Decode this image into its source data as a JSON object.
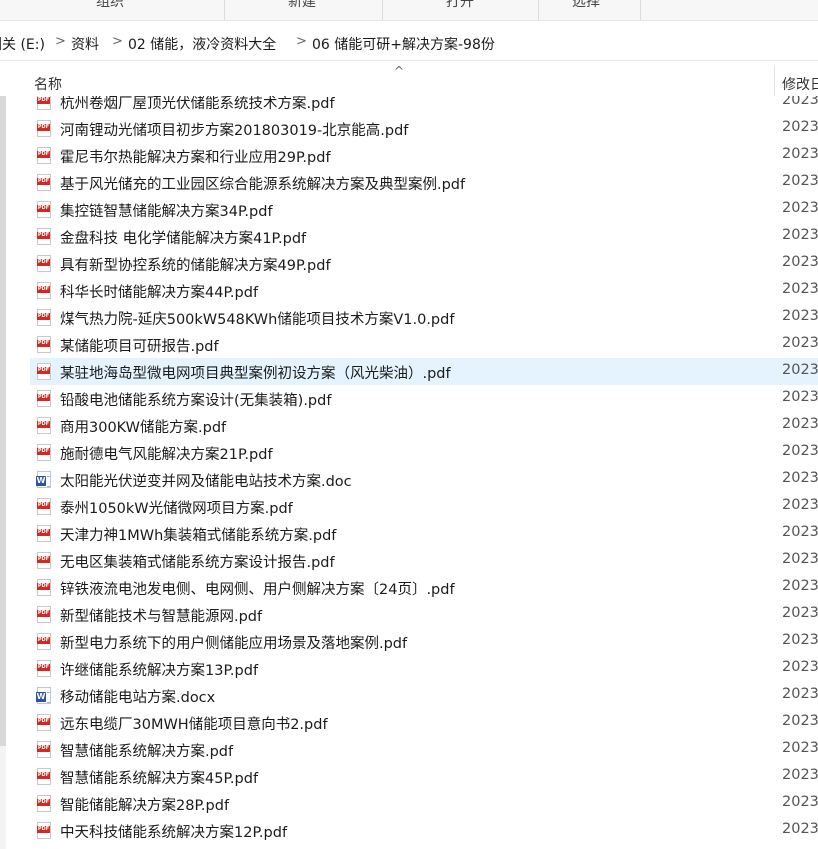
{
  "ribbon": {
    "groups": [
      {
        "label": "组织"
      },
      {
        "label": "新建"
      },
      {
        "label": "打开"
      },
      {
        "label": "选择"
      }
    ]
  },
  "address": {
    "crumbs": [
      {
        "label": "淵关 (E:)"
      },
      {
        "label": "资料"
      },
      {
        "label": "02 储能，液冷资料大全"
      },
      {
        "label": "06  储能可研+解决方案-98份"
      }
    ],
    "separator": ">"
  },
  "columns": {
    "name": "名称",
    "modified": "修改日",
    "sort_indicator": "^"
  },
  "files": [
    {
      "name": "杭州卷烟厂屋顶光伏储能系统技术方案.pdf",
      "date": "2023",
      "type": "pdf",
      "selected": false
    },
    {
      "name": "河南锂动光储项目初步方案201803019-北京能高.pdf",
      "date": "2023",
      "type": "pdf",
      "selected": false
    },
    {
      "name": "霍尼韦尔热能解决方案和行业应用29P.pdf",
      "date": "2023",
      "type": "pdf",
      "selected": false
    },
    {
      "name": "基于风光储充的工业园区综合能源系统解决方案及典型案例.pdf",
      "date": "2023",
      "type": "pdf",
      "selected": false
    },
    {
      "name": "集控链智慧储能解决方案34P.pdf",
      "date": "2023",
      "type": "pdf",
      "selected": false
    },
    {
      "name": "金盘科技 电化学储能解决方案41P.pdf",
      "date": "2023",
      "type": "pdf",
      "selected": false
    },
    {
      "name": "具有新型协控系统的储能解决方案49P.pdf",
      "date": "2023",
      "type": "pdf",
      "selected": false
    },
    {
      "name": "科华长时储能解决方案44P.pdf",
      "date": "2023",
      "type": "pdf",
      "selected": false
    },
    {
      "name": "煤气热力院-延庆500kW548KWh储能项目技术方案V1.0.pdf",
      "date": "2023",
      "type": "pdf",
      "selected": false
    },
    {
      "name": "某储能项目可研报告.pdf",
      "date": "2023",
      "type": "pdf",
      "selected": false
    },
    {
      "name": "某驻地海岛型微电网项目典型案例初设方案（风光柴油）.pdf",
      "date": "2023",
      "type": "pdf",
      "selected": true
    },
    {
      "name": "铅酸电池储能系统方案设计(无集装箱).pdf",
      "date": "2023",
      "type": "pdf",
      "selected": false
    },
    {
      "name": "商用300KW储能方案.pdf",
      "date": "2023",
      "type": "pdf",
      "selected": false
    },
    {
      "name": "施耐德电气风能解决方案21P.pdf",
      "date": "2023",
      "type": "pdf",
      "selected": false
    },
    {
      "name": "太阳能光伏逆变并网及储能电站技术方案.doc",
      "date": "2023",
      "type": "word",
      "selected": false
    },
    {
      "name": "泰州1050kW光储微网项目方案.pdf",
      "date": "2023",
      "type": "pdf",
      "selected": false
    },
    {
      "name": "天津力神1MWh集装箱式储能系统方案.pdf",
      "date": "2023",
      "type": "pdf",
      "selected": false
    },
    {
      "name": "无电区集装箱式储能系统方案设计报告.pdf",
      "date": "2023",
      "type": "pdf",
      "selected": false
    },
    {
      "name": "锌铁液流电池发电侧、电网侧、用户侧解决方案〔24页〕.pdf",
      "date": "2023",
      "type": "pdf",
      "selected": false
    },
    {
      "name": "新型储能技术与智慧能源网.pdf",
      "date": "2023",
      "type": "pdf",
      "selected": false
    },
    {
      "name": "新型电力系统下的用户侧储能应用场景及落地案例.pdf",
      "date": "2023",
      "type": "pdf",
      "selected": false
    },
    {
      "name": "许继储能系统解决方案13P.pdf",
      "date": "2023",
      "type": "pdf",
      "selected": false
    },
    {
      "name": "移动储能电站方案.docx",
      "date": "2023",
      "type": "word",
      "selected": false
    },
    {
      "name": "远东电缆厂30MWH储能项目意向书2.pdf",
      "date": "2023",
      "type": "pdf",
      "selected": false
    },
    {
      "name": "智慧储能系统解决方案.pdf",
      "date": "2023",
      "type": "pdf",
      "selected": false
    },
    {
      "name": "智慧储能系统解决方案45P.pdf",
      "date": "2023",
      "type": "pdf",
      "selected": false
    },
    {
      "name": "智能储能解决方案28P.pdf",
      "date": "2023",
      "type": "pdf",
      "selected": false
    },
    {
      "name": "中天科技储能系统解决方案12P.pdf",
      "date": "2023",
      "type": "pdf",
      "selected": false
    }
  ]
}
